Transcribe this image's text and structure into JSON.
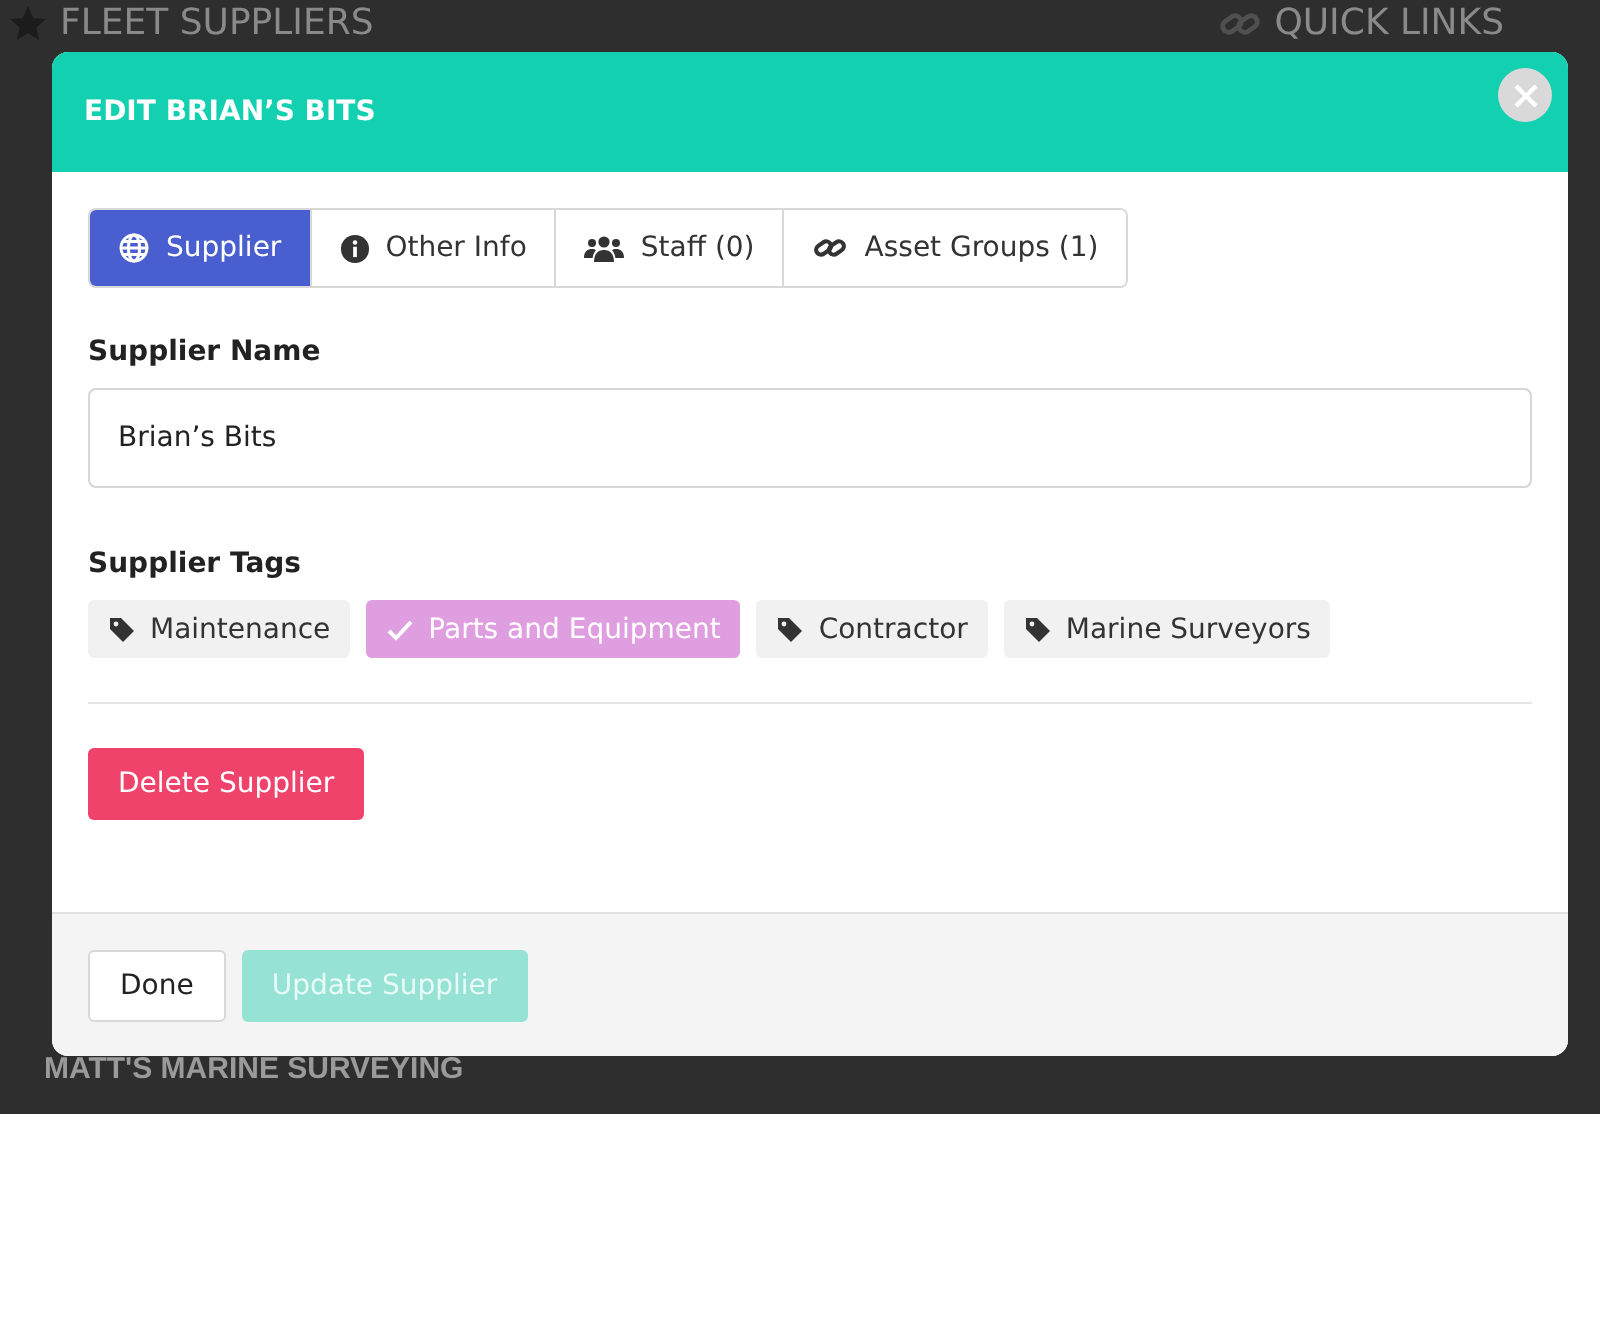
{
  "page": {
    "title": "FLEET SUPPLIERS",
    "quick_links_title": "QUICK LINKS",
    "supplier_heading": "MATT'S MARINE SURVEYING"
  },
  "modal": {
    "title": "EDIT BRIAN’S BITS",
    "tabs": [
      {
        "label": "Supplier",
        "selected": true
      },
      {
        "label": "Other Info",
        "selected": false
      },
      {
        "label": "Staff (0)",
        "selected": false
      },
      {
        "label": "Asset Groups (1)",
        "selected": false
      }
    ],
    "name_label": "Supplier Name",
    "name_value": "Brian’s Bits",
    "tags_label": "Supplier Tags",
    "tags": [
      {
        "label": "Maintenance",
        "selected": false
      },
      {
        "label": "Parts and Equipment",
        "selected": true
      },
      {
        "label": "Contractor",
        "selected": false
      },
      {
        "label": "Marine Surveyors",
        "selected": false
      }
    ],
    "delete_button": "Delete Supplier",
    "footer_buttons": [
      {
        "label": "Done",
        "kind": "default",
        "disabled": false
      },
      {
        "label": "Update Supplier",
        "kind": "primary",
        "disabled": true
      }
    ]
  }
}
